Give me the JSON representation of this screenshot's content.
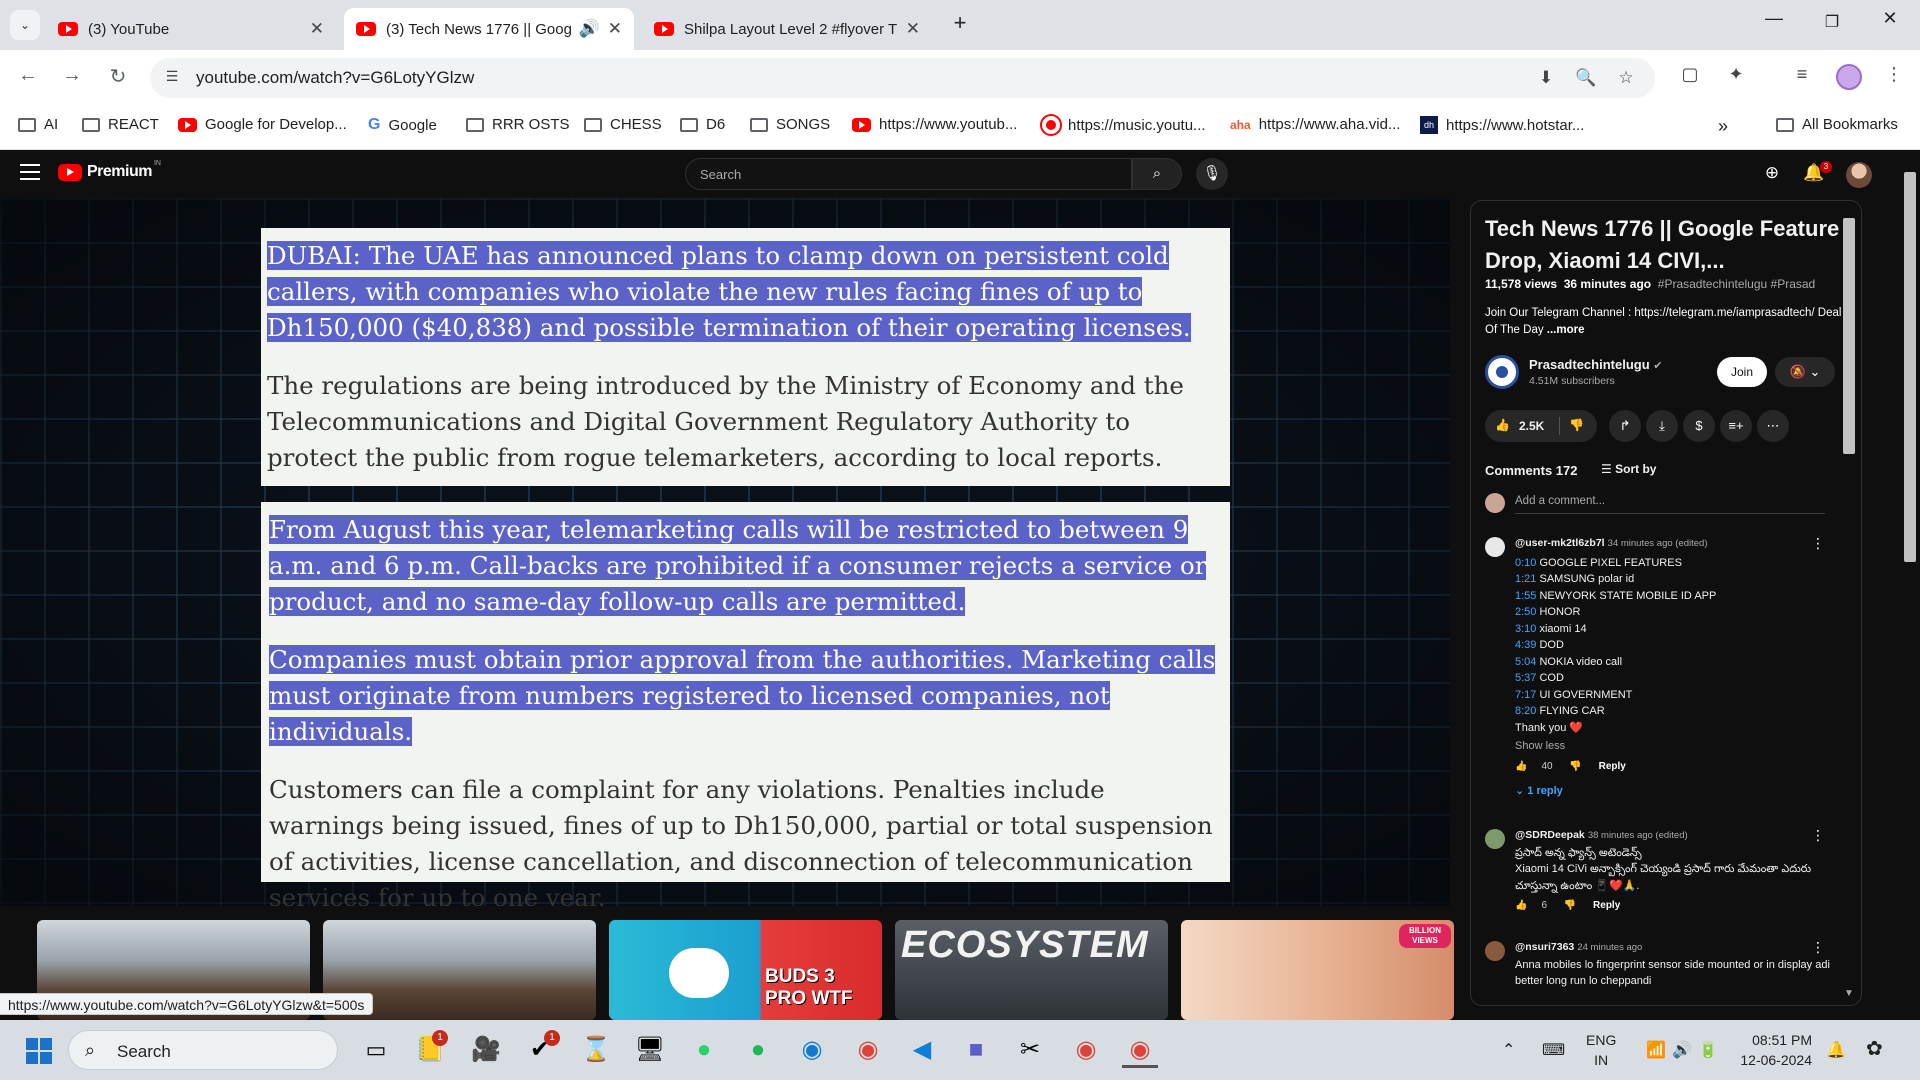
{
  "browser": {
    "tabs": [
      {
        "title": "(3) YouTube",
        "active": false
      },
      {
        "title": "(3) Tech News 1776 || Goog",
        "active": true,
        "audio": true
      },
      {
        "title": "Shilpa Layout Level 2 #flyover T",
        "active": false
      }
    ],
    "url": "youtube.com/watch?v=G6LotyYGlzw",
    "bookmarks": [
      {
        "label": "AI",
        "icon": "folder-icon"
      },
      {
        "label": "REACT",
        "icon": "folder-icon"
      },
      {
        "label": "Google for Develop...",
        "icon": "youtube-icon"
      },
      {
        "label": "Google",
        "icon": "google-icon"
      },
      {
        "label": "RRR OSTS",
        "icon": "folder-icon"
      },
      {
        "label": "CHESS",
        "icon": "folder-icon"
      },
      {
        "label": "D6",
        "icon": "folder-icon"
      },
      {
        "label": "SONGS",
        "icon": "folder-icon"
      },
      {
        "label": "https://www.youtub...",
        "icon": "youtube-icon"
      },
      {
        "label": "https://music.youtu...",
        "icon": "youtube-music-icon"
      },
      {
        "label": "https://www.aha.vid...",
        "icon": "aha-icon"
      },
      {
        "label": "https://www.hotstar...",
        "icon": "hotstar-icon"
      }
    ],
    "all_bookmarks": "All Bookmarks",
    "status_url": "https://www.youtube.com/watch?v=G6LotyYGlzw&t=500s"
  },
  "youtube": {
    "logo_text": "Premium",
    "logo_country": "IN",
    "search_placeholder": "Search",
    "notifications_count": "3"
  },
  "video": {
    "article_top": {
      "selected": "DUBAI: The UAE has announced plans to clamp down on persistent cold callers, with companies who violate the new rules facing fines of up to Dh150,000 ($40,838) and possible termination of their operating licenses.",
      "plain": "The regulations are being introduced by the Ministry of Economy and the Telecommunications and Digital Government Regulatory Authority to protect the public from rogue telemarketers, according to local reports."
    },
    "article_bottom": {
      "selected_1": "From August this year, telemarketing calls will be restricted to between 9 a.m. and 6 p.m. Call-backs are prohibited if a consumer rejects a service or product, and no same-day follow-up calls are permitted.",
      "selected_2": "Companies must obtain prior approval from the authorities. Marketing calls must originate from numbers registered to licensed companies, not individuals.",
      "plain": "Customers can file a complaint for any violations. Penalties include warnings being issued, fines of up to Dh150,000, partial or total suspension of activities, license cancellation, and disconnection of telecommunication services for up to one year."
    },
    "end_cards": [
      {
        "caption": ""
      },
      {
        "caption": ""
      },
      {
        "caption": "BUDS 3 PRO WTF"
      },
      {
        "caption": "ECOSYSTEM"
      },
      {
        "caption": "BILLION VIEWS"
      }
    ]
  },
  "panel": {
    "title": "Tech News 1776 || Google Feature Drop, Xiaomi 14 CIVI,...",
    "views": "11,578 views",
    "age": "36 minutes ago",
    "tags": "#Prasadtechintelugu #Prasad",
    "description": "Join Our  Telegram Channel : https://telegram.me/iamprasadtech/ Deal Of The Day",
    "more": "...more",
    "channel": {
      "name": "Prasadtechintelugu",
      "subscribers": "4.51M subscribers",
      "join": "Join"
    },
    "likes": "2.5K",
    "comments_label": "Comments 172",
    "sort_label": "Sort by",
    "add_comment_placeholder": "Add a comment...",
    "comments": [
      {
        "handle": "@user-mk2tl6zb7l",
        "ago": "34 minutes ago (edited)",
        "chapters": [
          {
            "t": "0:10",
            "label": "GOOGLE PIXEL FEATURES"
          },
          {
            "t": "1:21",
            "label": "SAMSUNG polar id"
          },
          {
            "t": "1:55",
            "label": "NEWYORK STATE MOBILE ID APP"
          },
          {
            "t": "2:50",
            "label": "HONOR"
          },
          {
            "t": "3:10",
            "label": "xiaomi 14"
          },
          {
            "t": "4:39",
            "label": "DOD"
          },
          {
            "t": "5:04",
            "label": "NOKIA video call"
          },
          {
            "t": "5:37",
            "label": "COD"
          },
          {
            "t": "7:17",
            "label": "UI GOVERNMENT"
          },
          {
            "t": "8:20",
            "label": "FLYING CAR"
          }
        ],
        "thanks": "Thank you ❤️",
        "show_less": "Show less",
        "likes": "40",
        "reply": "Reply",
        "replies": "1 reply"
      },
      {
        "handle": "@SDRDeepak",
        "ago": "38 minutes ago (edited)",
        "text_1": "ప్రసాద్ అన్న ఫ్యాన్స్ అటెండెన్స్",
        "text_2": "Xiaomi 14 CiVi అన్బాక్సింగ్ చెయ్యండి ప్రసాద్ గారు మేమంతా ఎదురు చూస్తున్నా ఉంటాం 📱❤️🙏.",
        "likes": "6",
        "reply": "Reply"
      },
      {
        "handle": "@nsuri7363",
        "ago": "24 minutes ago",
        "text": "Anna mobiles lo fingerprint sensor side mounted or in display adi better long run lo cheppandi"
      }
    ]
  },
  "taskbar": {
    "search_label": "Search",
    "lang_1": "ENG",
    "lang_2": "IN",
    "time": "08:51 PM",
    "date": "12-06-2024",
    "badge_1": "1",
    "badge_2": "1"
  }
}
